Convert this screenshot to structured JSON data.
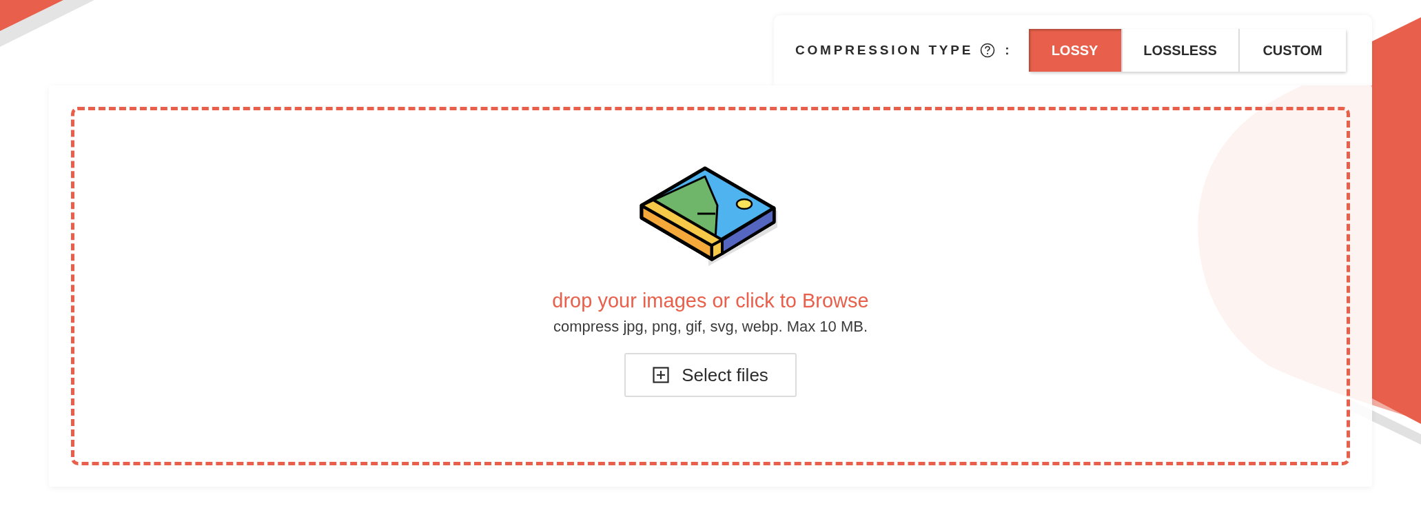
{
  "compression": {
    "label": "COMPRESSION TYPE",
    "separator": ":",
    "options": [
      {
        "label": "LOSSY",
        "selected": true
      },
      {
        "label": "LOSSLESS",
        "selected": false
      },
      {
        "label": "CUSTOM",
        "selected": false
      }
    ]
  },
  "dropzone": {
    "title": "drop your images or click to Browse",
    "subtitle": "compress jpg, png, gif, svg, webp. Max 10 MB.",
    "button": "Select files"
  }
}
